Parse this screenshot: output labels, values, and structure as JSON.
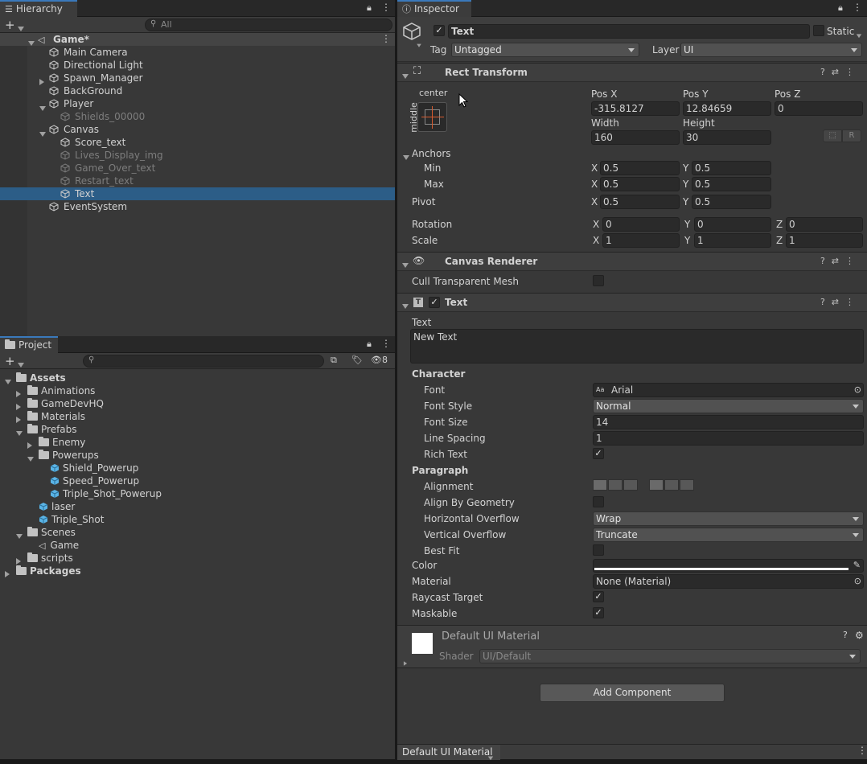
{
  "hierarchy": {
    "tab": "Hierarchy",
    "search_placeholder": "All",
    "scene": "Game*",
    "items": [
      {
        "label": "Main Camera",
        "depth": 1,
        "arrow": "",
        "dim": false
      },
      {
        "label": "Directional Light",
        "depth": 1,
        "arrow": "",
        "dim": false
      },
      {
        "label": "Spawn_Manager",
        "depth": 1,
        "arrow": "right",
        "dim": false
      },
      {
        "label": "BackGround",
        "depth": 1,
        "arrow": "",
        "dim": false
      },
      {
        "label": "Player",
        "depth": 1,
        "arrow": "down",
        "dim": false
      },
      {
        "label": "Shields_00000",
        "depth": 2,
        "arrow": "",
        "dim": true
      },
      {
        "label": "Canvas",
        "depth": 1,
        "arrow": "down",
        "dim": false
      },
      {
        "label": "Score_text",
        "depth": 2,
        "arrow": "",
        "dim": false
      },
      {
        "label": "Lives_Display_img",
        "depth": 2,
        "arrow": "",
        "dim": true
      },
      {
        "label": "Game_Over_text",
        "depth": 2,
        "arrow": "",
        "dim": true
      },
      {
        "label": "Restart_text",
        "depth": 2,
        "arrow": "",
        "dim": true
      },
      {
        "label": "Text",
        "depth": 2,
        "arrow": "",
        "dim": false,
        "selected": true
      },
      {
        "label": "EventSystem",
        "depth": 1,
        "arrow": "",
        "dim": false
      }
    ]
  },
  "project": {
    "tab": "Project",
    "hidden_count": "8",
    "items": [
      {
        "label": "Assets",
        "depth": 0,
        "arrow": "down",
        "type": "folder",
        "bold": true
      },
      {
        "label": "Animations",
        "depth": 1,
        "arrow": "right",
        "type": "folder"
      },
      {
        "label": "GameDevHQ",
        "depth": 1,
        "arrow": "right",
        "type": "folder"
      },
      {
        "label": "Materials",
        "depth": 1,
        "arrow": "right",
        "type": "folder"
      },
      {
        "label": "Prefabs",
        "depth": 1,
        "arrow": "down",
        "type": "folder"
      },
      {
        "label": "Enemy",
        "depth": 2,
        "arrow": "right",
        "type": "folder"
      },
      {
        "label": "Powerups",
        "depth": 2,
        "arrow": "down",
        "type": "folder"
      },
      {
        "label": "Shield_Powerup",
        "depth": 3,
        "arrow": "",
        "type": "prefab"
      },
      {
        "label": "Speed_Powerup",
        "depth": 3,
        "arrow": "",
        "type": "prefab"
      },
      {
        "label": "Triple_Shot_Powerup",
        "depth": 3,
        "arrow": "",
        "type": "prefab"
      },
      {
        "label": "laser",
        "depth": 2,
        "arrow": "",
        "type": "prefab"
      },
      {
        "label": "Triple_Shot",
        "depth": 2,
        "arrow": "",
        "type": "prefab"
      },
      {
        "label": "Scenes",
        "depth": 1,
        "arrow": "down",
        "type": "folder"
      },
      {
        "label": "Game",
        "depth": 2,
        "arrow": "",
        "type": "scene"
      },
      {
        "label": "scripts",
        "depth": 1,
        "arrow": "right",
        "type": "folder"
      },
      {
        "label": "Packages",
        "depth": 0,
        "arrow": "right",
        "type": "folder",
        "bold": true
      }
    ]
  },
  "inspector": {
    "tab": "Inspector",
    "object_name": "Text",
    "static_label": "Static",
    "tag_label": "Tag",
    "tag_value": "Untagged",
    "layer_label": "Layer",
    "layer_value": "UI",
    "rect": {
      "title": "Rect Transform",
      "anchor_h": "center",
      "anchor_v": "middle",
      "posx_label": "Pos X",
      "posx": "-315.8127",
      "posy_label": "Pos Y",
      "posy": "12.84659",
      "posz_label": "Pos Z",
      "posz": "0",
      "width_label": "Width",
      "width": "160",
      "height_label": "Height",
      "height": "30",
      "r_button": "R",
      "anchors_label": "Anchors",
      "min_label": "Min",
      "min_x": "0.5",
      "min_y": "0.5",
      "max_label": "Max",
      "max_x": "0.5",
      "max_y": "0.5",
      "pivot_label": "Pivot",
      "pivot_x": "0.5",
      "pivot_y": "0.5",
      "rotation_label": "Rotation",
      "rot_x": "0",
      "rot_y": "0",
      "rot_z": "0",
      "scale_label": "Scale",
      "scale_x": "1",
      "scale_y": "1",
      "scale_z": "1",
      "x": "X",
      "y": "Y",
      "z": "Z"
    },
    "canvas_renderer": {
      "title": "Canvas Renderer",
      "cull_label": "Cull Transparent Mesh"
    },
    "text": {
      "title": "Text",
      "text_label": "Text",
      "text_value": "New Text",
      "character_label": "Character",
      "font_label": "Font",
      "font_value": "Arial",
      "font_style_label": "Font Style",
      "font_style_value": "Normal",
      "font_size_label": "Font Size",
      "font_size_value": "14",
      "line_spacing_label": "Line Spacing",
      "line_spacing_value": "1",
      "rich_text_label": "Rich Text",
      "paragraph_label": "Paragraph",
      "alignment_label": "Alignment",
      "align_geom_label": "Align By Geometry",
      "h_overflow_label": "Horizontal Overflow",
      "h_overflow_value": "Wrap",
      "v_overflow_label": "Vertical Overflow",
      "v_overflow_value": "Truncate",
      "best_fit_label": "Best Fit",
      "color_label": "Color",
      "material_label": "Material",
      "material_value": "None (Material)",
      "raycast_label": "Raycast Target",
      "maskable_label": "Maskable"
    },
    "material": {
      "name": "Default UI Material",
      "shader_label": "Shader",
      "shader_value": "UI/Default"
    },
    "add_component": "Add Component",
    "footer_dropdown": "Default UI Material"
  }
}
